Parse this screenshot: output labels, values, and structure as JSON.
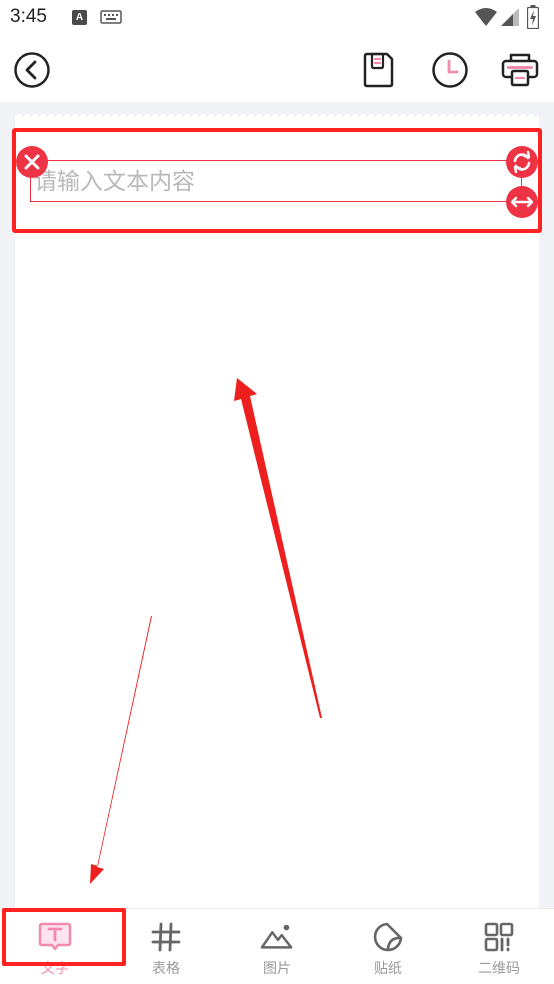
{
  "status_bar": {
    "time": "3:45",
    "notification_badge": "A"
  },
  "toolbar": {
    "back_icon": "chevron-left-icon",
    "save_icon": "save-icon",
    "history_icon": "clock-icon",
    "print_icon": "printer-icon"
  },
  "editor": {
    "text_placeholder": "请输入文本内容",
    "accent_color": "#ee3344",
    "highlight_color": "#ff2222"
  },
  "bottom_nav": {
    "items": [
      {
        "label": "文字",
        "icon": "text-icon",
        "active": true
      },
      {
        "label": "表格",
        "icon": "hash-icon",
        "active": false
      },
      {
        "label": "图片",
        "icon": "image-icon",
        "active": false
      },
      {
        "label": "贴纸",
        "icon": "sticker-icon",
        "active": false
      },
      {
        "label": "二维码",
        "icon": "qrcode-icon",
        "active": false
      }
    ],
    "active_color": "#f28ab0",
    "inactive_color": "#9a9a9a"
  }
}
